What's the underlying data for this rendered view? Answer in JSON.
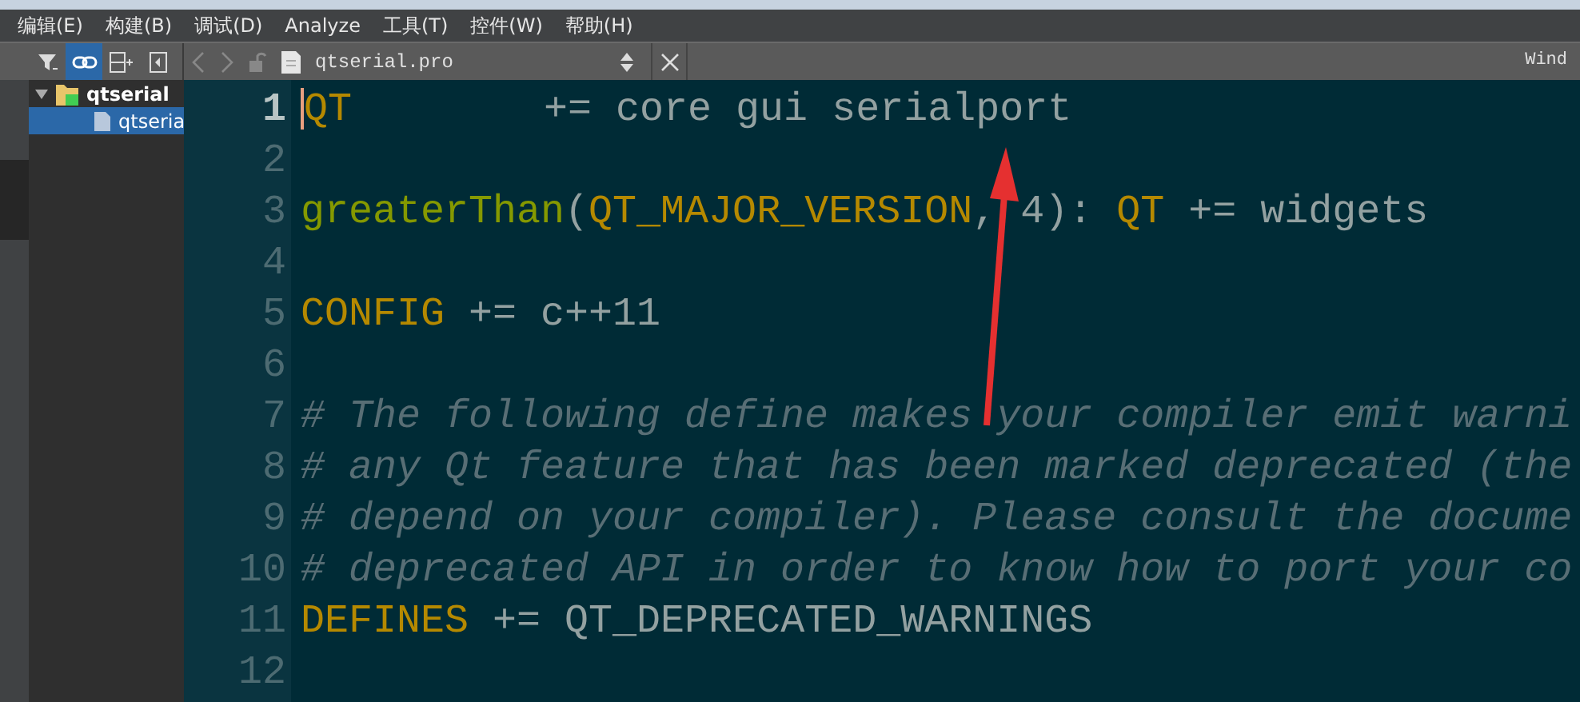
{
  "menu_bar": [
    "编辑(E)",
    "构建(B)",
    "调试(D)",
    "Analyze",
    "工具(T)",
    "控件(W)",
    "帮助(H)"
  ],
  "sidebar_toolbar": {
    "link_selected": true
  },
  "editor_toolbar": {
    "file_name": "qtserial.pro",
    "right_label": "Wind"
  },
  "project_tree": [
    {
      "label": "qtserial",
      "expanded": true,
      "selected": false,
      "children": [
        {
          "label": "qtseria",
          "selected": true
        }
      ]
    }
  ],
  "editor": {
    "lines": [
      {
        "number": "1",
        "current": true,
        "tokens": [
          {
            "kind": "keyword",
            "text": "QT"
          },
          {
            "kind": "plain",
            "text": "        += core gui serialport"
          }
        ]
      },
      {
        "number": "2",
        "current": false
      },
      {
        "number": "3",
        "current": false,
        "tokens": [
          {
            "kind": "function",
            "text": "greaterThan"
          },
          {
            "kind": "plain",
            "text": "("
          },
          {
            "kind": "keyword",
            "text": "QT_MAJOR_VERSION"
          },
          {
            "kind": "plain",
            "text": ", 4): "
          },
          {
            "kind": "keyword",
            "text": "QT"
          },
          {
            "kind": "plain",
            "text": " += widgets"
          }
        ]
      },
      {
        "number": "4",
        "current": false
      },
      {
        "number": "5",
        "current": false,
        "tokens": [
          {
            "kind": "keyword",
            "text": "CONFIG"
          },
          {
            "kind": "plain",
            "text": " += c++11"
          }
        ]
      },
      {
        "number": "6",
        "current": false
      },
      {
        "number": "7",
        "current": false,
        "tokens": [
          {
            "kind": "comment",
            "text": "# The following define makes your compiler emit warni"
          }
        ]
      },
      {
        "number": "8",
        "current": false,
        "tokens": [
          {
            "kind": "comment",
            "text": "# any Qt feature that has been marked deprecated (the"
          }
        ]
      },
      {
        "number": "9",
        "current": false,
        "tokens": [
          {
            "kind": "comment",
            "text": "# depend on your compiler). Please consult the docume"
          }
        ]
      },
      {
        "number": "10",
        "current": false,
        "tokens": [
          {
            "kind": "comment",
            "text": "# deprecated API in order to know how to port your co"
          }
        ]
      },
      {
        "number": "11",
        "current": false,
        "tokens": [
          {
            "kind": "keyword",
            "text": "DEFINES"
          },
          {
            "kind": "plain",
            "text": " += QT_DEPRECATED_WARNINGS"
          }
        ]
      },
      {
        "number": "12",
        "current": false
      }
    ]
  }
}
